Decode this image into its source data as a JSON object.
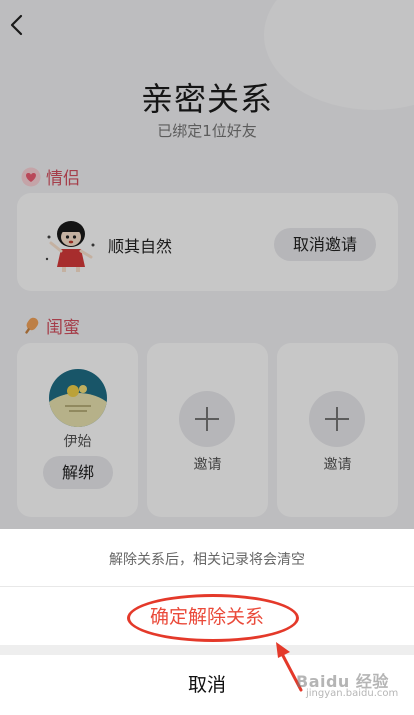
{
  "header": {
    "back_icon": "chevron-left-icon",
    "title": "亲密关系",
    "subtitle": "已绑定1位好友"
  },
  "couple_section": {
    "icon": "heart-icon",
    "label": "情侣",
    "partner": {
      "name": "顺其自然",
      "action_label": "取消邀请"
    }
  },
  "bestie_section": {
    "icon": "popsicle-icon",
    "label": "闺蜜",
    "slots": [
      {
        "type": "friend",
        "name": "伊始",
        "action_label": "解绑"
      },
      {
        "type": "invite",
        "label": "邀请"
      },
      {
        "type": "invite",
        "label": "邀请"
      }
    ]
  },
  "action_sheet": {
    "tip": "解除关系后，相关记录将会清空",
    "confirm_label": "确定解除关系",
    "cancel_label": "取消"
  },
  "watermark": {
    "text": "Baidu 经验",
    "sub": "jingyan.baidu.com"
  },
  "colors": {
    "accent_red": "#ea4a3a",
    "section_label": "#d4505f",
    "annotation": "#e4392a"
  }
}
